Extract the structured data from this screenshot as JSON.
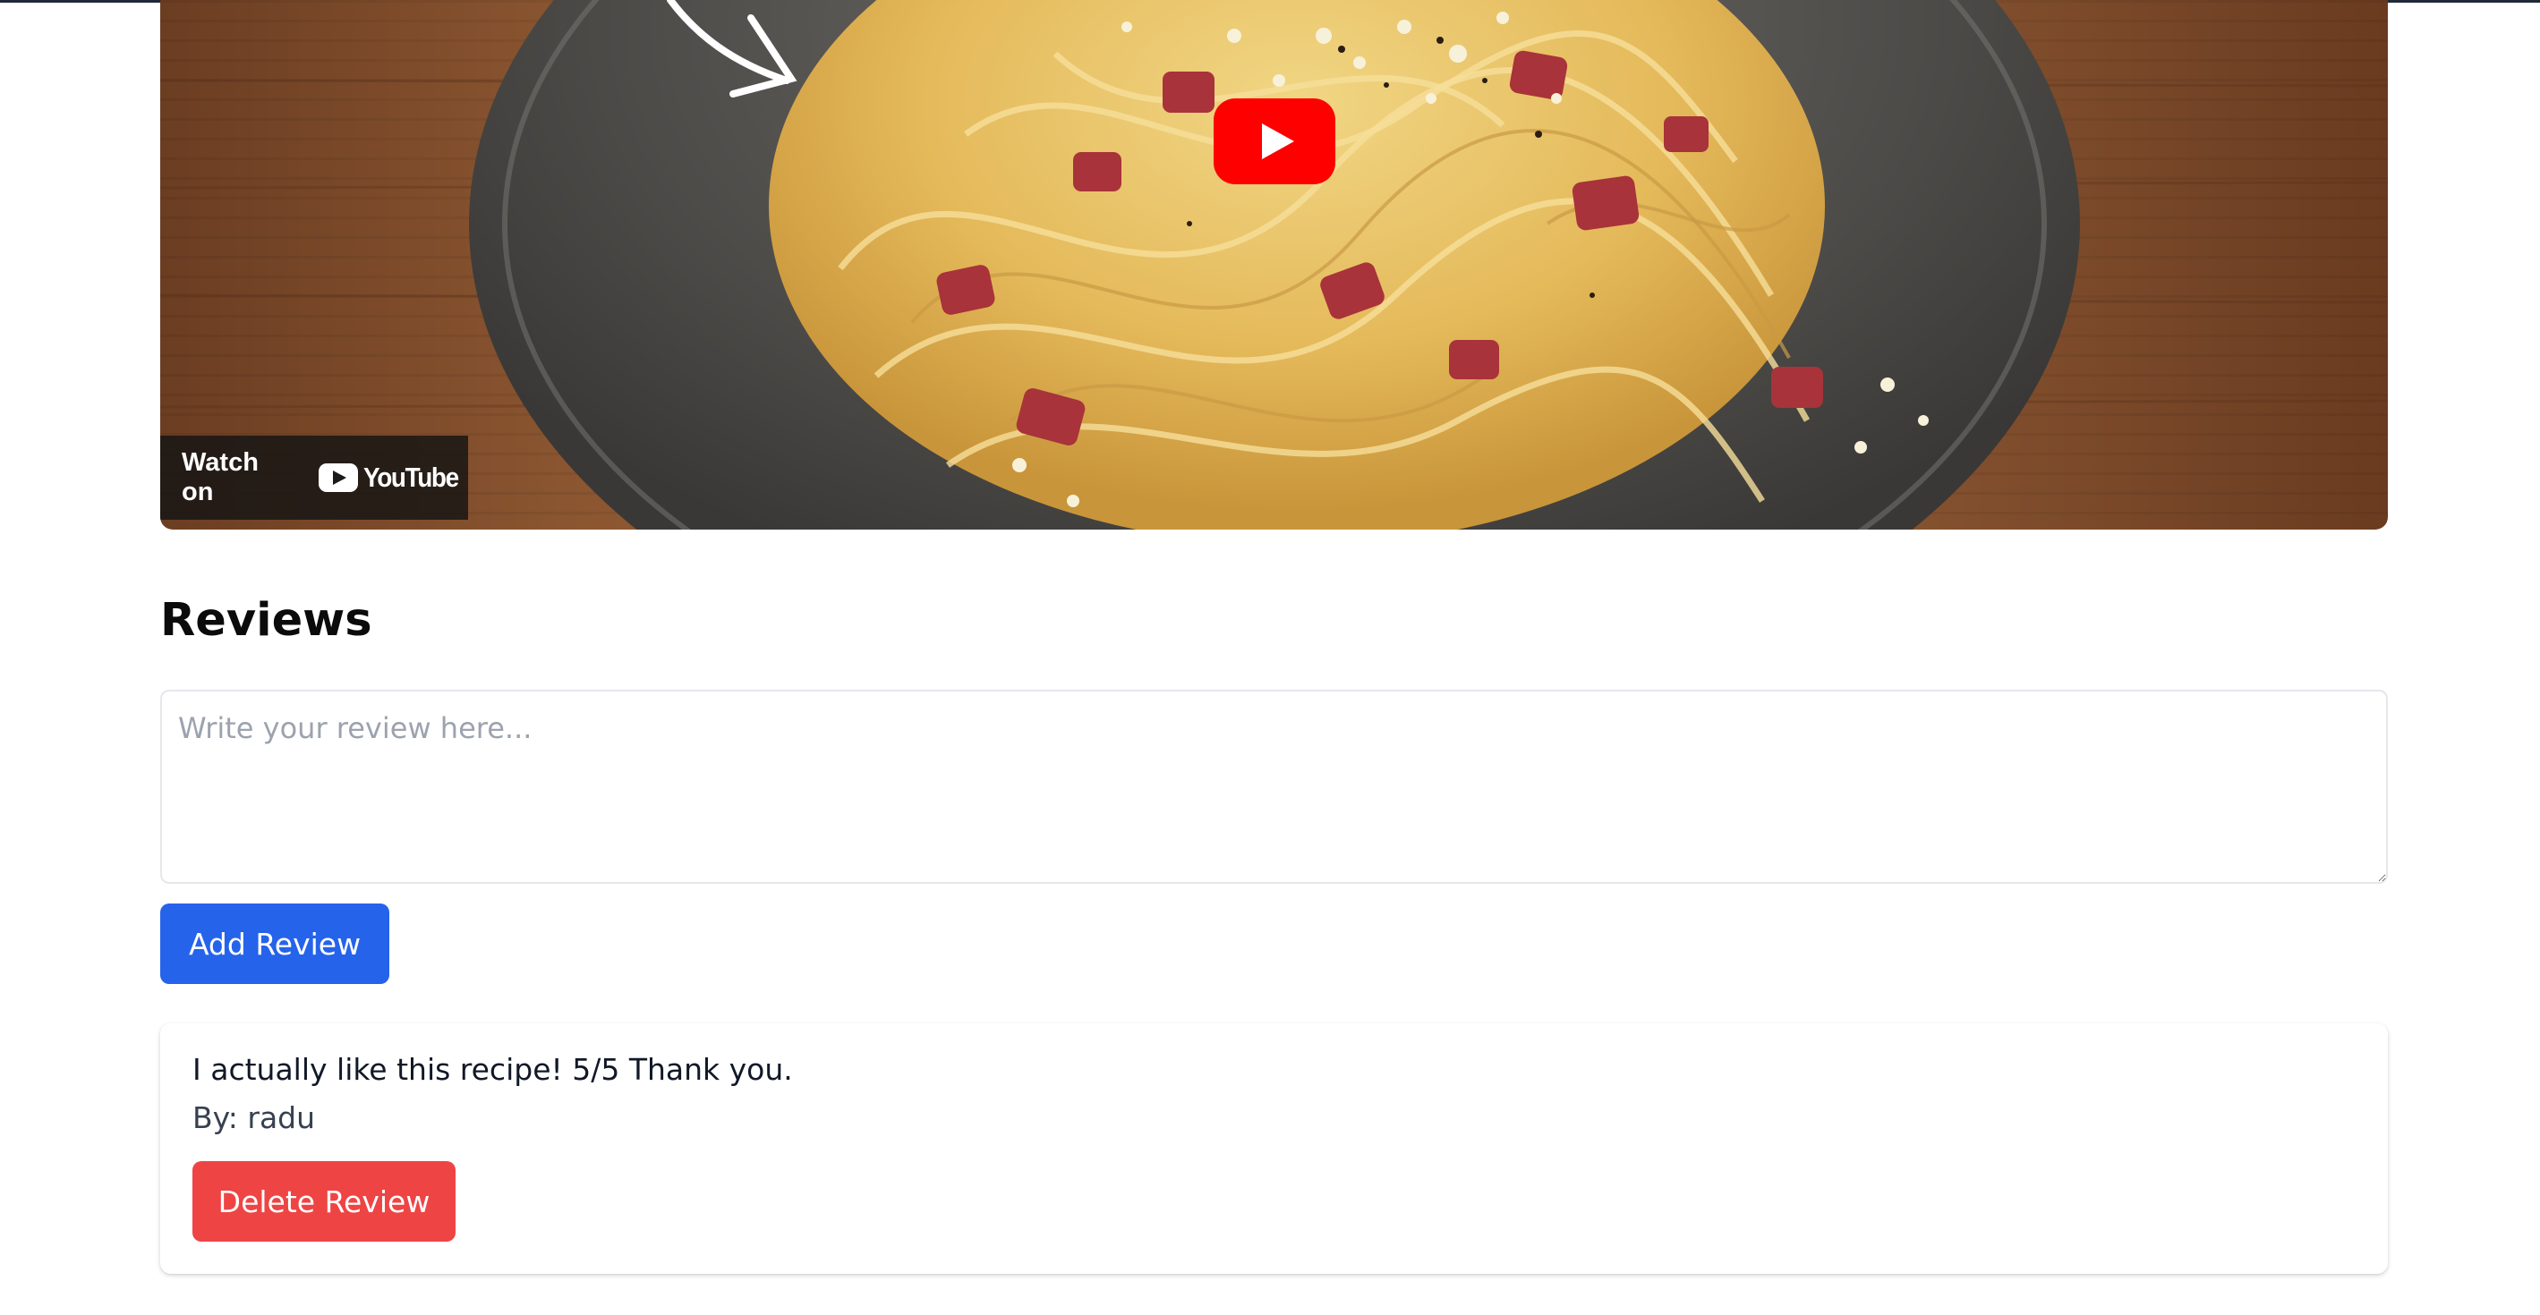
{
  "video": {
    "watch_on_label": "Watch on",
    "youtube_wordmark": "YouTube",
    "play_icon": "play-icon",
    "colors": {
      "play_button": "#ff0000"
    }
  },
  "reviews": {
    "heading": "Reviews",
    "textarea_placeholder": "Write your review here...",
    "textarea_value": "",
    "add_button_label": "Add Review",
    "items": [
      {
        "text": "I actually like this recipe! 5/5 Thank you.",
        "author_line": "By: radu",
        "delete_button_label": "Delete Review"
      }
    ]
  },
  "colors": {
    "primary": "#2563eb",
    "danger": "#ef4444",
    "text": "#111827",
    "muted_text": "#374151",
    "placeholder": "#9ca3af",
    "border": "#e5e7eb"
  }
}
